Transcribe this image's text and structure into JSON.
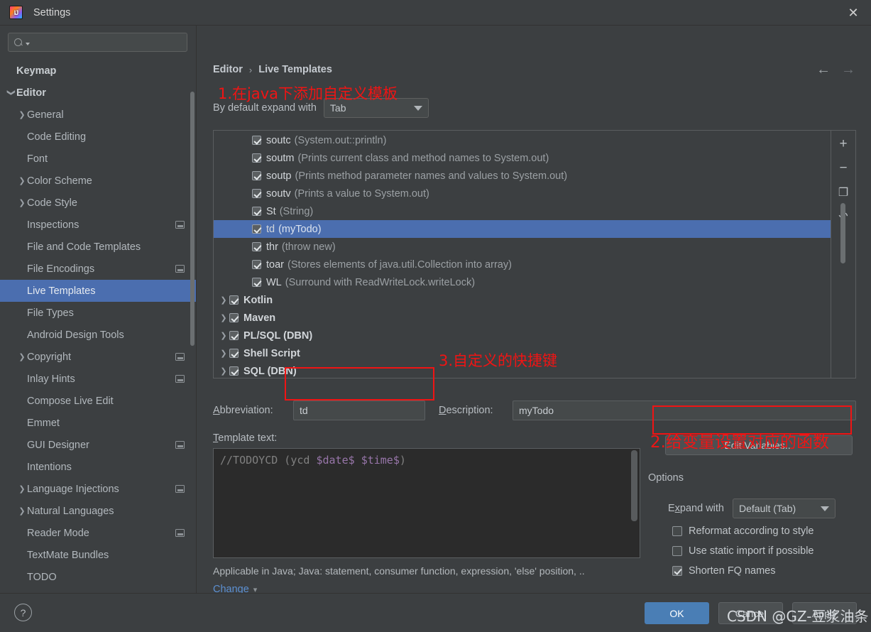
{
  "window": {
    "title": "Settings",
    "app_icon": "intellij-idea-logo",
    "close_icon": "close-icon"
  },
  "sidebar": {
    "search": {
      "placeholder": "",
      "value": "",
      "icon": "search-icon"
    },
    "items": [
      {
        "label": "Keymap",
        "indent": 0,
        "arrow": "",
        "bold": true,
        "badge": false,
        "selected": false
      },
      {
        "label": "Editor",
        "indent": 0,
        "arrow": "v",
        "bold": true,
        "badge": false,
        "selected": false
      },
      {
        "label": "General",
        "indent": 1,
        "arrow": ">",
        "bold": false,
        "badge": false,
        "selected": false
      },
      {
        "label": "Code Editing",
        "indent": 1,
        "arrow": "",
        "bold": false,
        "badge": false,
        "selected": false
      },
      {
        "label": "Font",
        "indent": 1,
        "arrow": "",
        "bold": false,
        "badge": false,
        "selected": false
      },
      {
        "label": "Color Scheme",
        "indent": 1,
        "arrow": ">",
        "bold": false,
        "badge": false,
        "selected": false
      },
      {
        "label": "Code Style",
        "indent": 1,
        "arrow": ">",
        "bold": false,
        "badge": false,
        "selected": false
      },
      {
        "label": "Inspections",
        "indent": 1,
        "arrow": "",
        "bold": false,
        "badge": true,
        "selected": false
      },
      {
        "label": "File and Code Templates",
        "indent": 1,
        "arrow": "",
        "bold": false,
        "badge": false,
        "selected": false
      },
      {
        "label": "File Encodings",
        "indent": 1,
        "arrow": "",
        "bold": false,
        "badge": true,
        "selected": false
      },
      {
        "label": "Live Templates",
        "indent": 1,
        "arrow": "",
        "bold": false,
        "badge": false,
        "selected": true
      },
      {
        "label": "File Types",
        "indent": 1,
        "arrow": "",
        "bold": false,
        "badge": false,
        "selected": false
      },
      {
        "label": "Android Design Tools",
        "indent": 1,
        "arrow": "",
        "bold": false,
        "badge": false,
        "selected": false
      },
      {
        "label": "Copyright",
        "indent": 1,
        "arrow": ">",
        "bold": false,
        "badge": true,
        "selected": false
      },
      {
        "label": "Inlay Hints",
        "indent": 1,
        "arrow": "",
        "bold": false,
        "badge": true,
        "selected": false
      },
      {
        "label": "Compose Live Edit",
        "indent": 1,
        "arrow": "",
        "bold": false,
        "badge": false,
        "selected": false
      },
      {
        "label": "Emmet",
        "indent": 1,
        "arrow": "",
        "bold": false,
        "badge": false,
        "selected": false
      },
      {
        "label": "GUI Designer",
        "indent": 1,
        "arrow": "",
        "bold": false,
        "badge": true,
        "selected": false
      },
      {
        "label": "Intentions",
        "indent": 1,
        "arrow": "",
        "bold": false,
        "badge": false,
        "selected": false
      },
      {
        "label": "Language Injections",
        "indent": 1,
        "arrow": ">",
        "bold": false,
        "badge": true,
        "selected": false
      },
      {
        "label": "Natural Languages",
        "indent": 1,
        "arrow": ">",
        "bold": false,
        "badge": false,
        "selected": false
      },
      {
        "label": "Reader Mode",
        "indent": 1,
        "arrow": "",
        "bold": false,
        "badge": true,
        "selected": false
      },
      {
        "label": "TextMate Bundles",
        "indent": 1,
        "arrow": "",
        "bold": false,
        "badge": false,
        "selected": false
      },
      {
        "label": "TODO",
        "indent": 1,
        "arrow": "",
        "bold": false,
        "badge": false,
        "selected": false
      }
    ]
  },
  "main": {
    "breadcrumb": {
      "parent": "Editor",
      "separator": "›",
      "current": "Live Templates"
    },
    "nav": {
      "back_icon": "arrow-left-icon",
      "forward_icon": "arrow-right-icon"
    },
    "expand_with": {
      "label": "By default expand with",
      "value": "Tab"
    },
    "templates": [
      {
        "arrow": "",
        "name": "soutc",
        "desc": "(System.out::println)",
        "checked": true,
        "group": false,
        "selected": false
      },
      {
        "arrow": "",
        "name": "soutm",
        "desc": "(Prints current class and method names to System.out)",
        "checked": true,
        "group": false,
        "selected": false
      },
      {
        "arrow": "",
        "name": "soutp",
        "desc": "(Prints method parameter names and values to System.out)",
        "checked": true,
        "group": false,
        "selected": false
      },
      {
        "arrow": "",
        "name": "soutv",
        "desc": "(Prints a value to System.out)",
        "checked": true,
        "group": false,
        "selected": false
      },
      {
        "arrow": "",
        "name": "St",
        "desc": "(String)",
        "checked": true,
        "group": false,
        "selected": false
      },
      {
        "arrow": "",
        "name": "td",
        "desc": "(myTodo)",
        "checked": true,
        "group": false,
        "selected": true
      },
      {
        "arrow": "",
        "name": "thr",
        "desc": "(throw new)",
        "checked": true,
        "group": false,
        "selected": false
      },
      {
        "arrow": "",
        "name": "toar",
        "desc": "(Stores elements of java.util.Collection into array)",
        "checked": true,
        "group": false,
        "selected": false
      },
      {
        "arrow": "",
        "name": "WL",
        "desc": "(Surround with ReadWriteLock.writeLock)",
        "checked": true,
        "group": false,
        "selected": false
      },
      {
        "arrow": ">",
        "name": "Kotlin",
        "desc": "",
        "checked": true,
        "group": true,
        "selected": false
      },
      {
        "arrow": ">",
        "name": "Maven",
        "desc": "",
        "checked": true,
        "group": true,
        "selected": false
      },
      {
        "arrow": ">",
        "name": "PL/SQL (DBN)",
        "desc": "",
        "checked": true,
        "group": true,
        "selected": false
      },
      {
        "arrow": ">",
        "name": "Shell Script",
        "desc": "",
        "checked": true,
        "group": true,
        "selected": false
      },
      {
        "arrow": ">",
        "name": "SQL (DBN)",
        "desc": "",
        "checked": true,
        "group": true,
        "selected": false
      }
    ],
    "list_toolbar": [
      {
        "icon": "add-icon",
        "glyph": "+"
      },
      {
        "icon": "remove-icon",
        "glyph": "−"
      },
      {
        "icon": "duplicate-icon",
        "glyph": "❐"
      },
      {
        "icon": "revert-icon",
        "glyph": "↶"
      }
    ],
    "abbreviation": {
      "label": "Abbreviation:",
      "value": "td"
    },
    "description": {
      "label": "Description:",
      "value": "myTodo"
    },
    "template_text": {
      "label": "Template text:",
      "prefix": "//TODOYCD (ycd ",
      "var1": "$date$",
      "mid": " ",
      "var2": "$time$",
      "suffix": ")"
    },
    "edit_variables_button": "Edit Variables...",
    "options": {
      "title": "Options",
      "expand_with_label": "Expand with",
      "expand_with_value": "Default (Tab)",
      "checkboxes": [
        {
          "label": "Reformat according to style",
          "checked": false
        },
        {
          "label": "Use static import if possible",
          "checked": false
        },
        {
          "label": "Shorten FQ names",
          "checked": true
        }
      ]
    },
    "applicable_text": "Applicable in Java; Java: statement, consumer function, expression, 'else' position, ..",
    "change_link": "Change"
  },
  "footer": {
    "help_icon": "help-icon",
    "ok_label": "OK",
    "cancel_label": "Cancel",
    "apply_label": "Apply"
  },
  "annotations": [
    {
      "id": "1",
      "text": "1.在java下添加自定义模板"
    },
    {
      "id": "2",
      "text": "2.给变量设置对应的函数"
    },
    {
      "id": "3",
      "text": "3.自定义的快捷键"
    }
  ],
  "watermark": "CSDN @GZ-豆浆油条",
  "colors": {
    "background": "#3c3f41",
    "selection": "#4b6eaf",
    "accent_button": "#4a7eb5",
    "annotation_red": "#f01414",
    "link_blue": "#5c90d2",
    "editor_bg": "#2b2b2b",
    "template_var": "#9876aa"
  }
}
